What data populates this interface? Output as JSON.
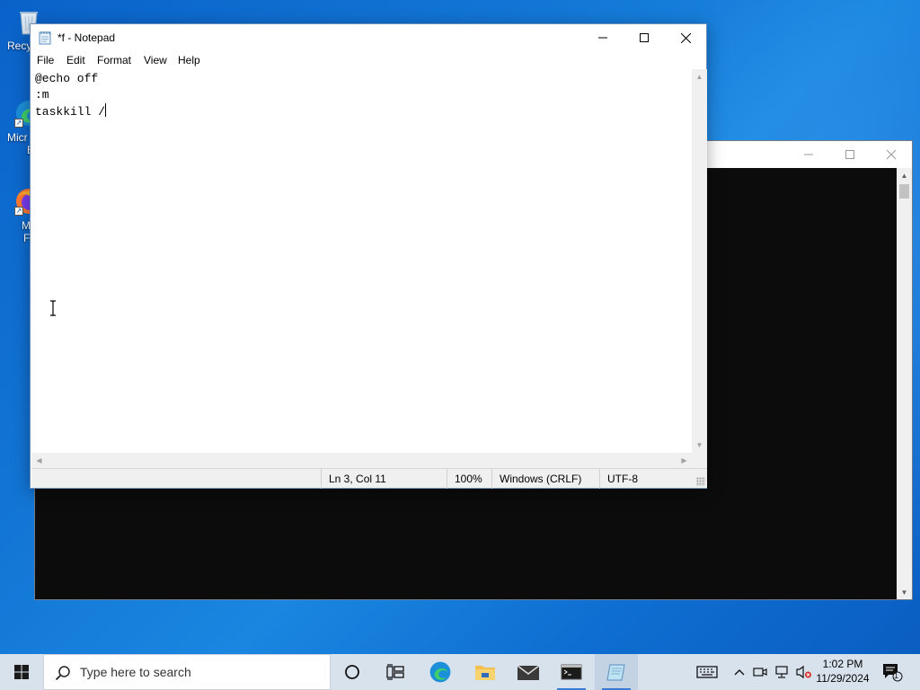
{
  "desktop": {
    "icons": [
      {
        "label": "Recy"
      },
      {
        "label": "Micr",
        "label2": "E"
      },
      {
        "label": "Mo",
        "label2": "Fir"
      }
    ]
  },
  "notepad": {
    "title": "*f - Notepad",
    "menu": [
      "File",
      "Edit",
      "Format",
      "View",
      "Help"
    ],
    "lines": [
      "@echo off",
      ":m",
      "taskkill /"
    ],
    "status": {
      "position": "Ln 3, Col 11",
      "zoom": "100%",
      "line_ending": "Windows (CRLF)",
      "encoding": "UTF-8"
    }
  },
  "taskbar": {
    "search_placeholder": "Type here to search",
    "time": "1:02 PM",
    "date": "11/29/2024",
    "notification_count": "1",
    "pinned": [
      "start-icon",
      "task-view-icon",
      "edge-icon",
      "file-explorer-icon",
      "mail-icon",
      "terminal-icon",
      "notepad-icon"
    ]
  },
  "colors": {
    "accent": "#3a7bd5",
    "console_bg": "#0c0c0c",
    "taskbar_bg": "#d8e2ed"
  }
}
